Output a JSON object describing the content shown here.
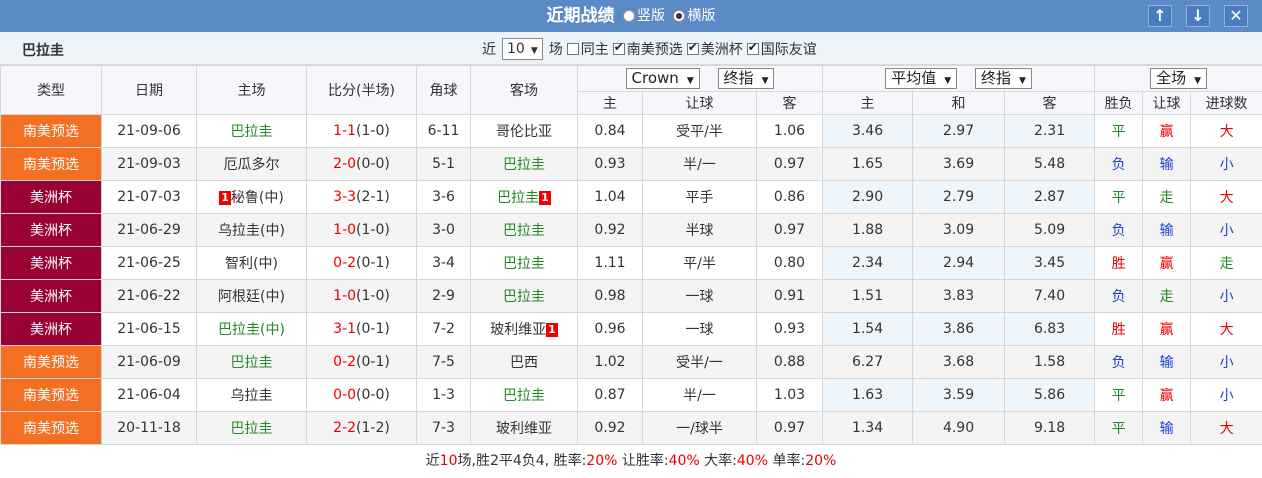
{
  "header": {
    "title": "近期战绩",
    "layout_options": [
      {
        "label": "竖版",
        "selected": false
      },
      {
        "label": "横版",
        "selected": true
      }
    ],
    "buttons": [
      "↑",
      "↓",
      "✕"
    ]
  },
  "filter": {
    "team": "巴拉圭",
    "recent_prefix": "近",
    "recent_count": "10",
    "recent_suffix": "场",
    "checkboxes": [
      {
        "label": "同主",
        "checked": false
      },
      {
        "label": "南美预选",
        "checked": true
      },
      {
        "label": "美洲杯",
        "checked": true
      },
      {
        "label": "国际友谊",
        "checked": true
      }
    ]
  },
  "table": {
    "headers": {
      "type": "类型",
      "date": "日期",
      "home": "主场",
      "score": "比分(半场)",
      "corners": "角球",
      "away": "客场",
      "odds_company": "Crown",
      "odds_kind": "终指",
      "eu_type": "平均值",
      "eu_kind": "终指",
      "result_scope": "全场",
      "sub": {
        "ah_home": "主",
        "ah_line": "让球",
        "ah_away": "客",
        "eu_home": "主",
        "eu_draw": "和",
        "eu_away": "客",
        "wdl": "胜负",
        "handicap_result": "让球",
        "goals": "进球数"
      }
    },
    "rows": [
      {
        "league": "南美预选",
        "league_color": "#f36f21",
        "date": "21-09-06",
        "home": "巴拉圭",
        "home_color": "green",
        "home_rank": "",
        "score": "1-1",
        "half": "(1-0)",
        "corners": "6-11",
        "away": "哥伦比亚",
        "away_color": "normal",
        "away_rank": "",
        "ah_home": "0.84",
        "ah_line": "受平/半",
        "ah_away": "1.06",
        "eu_home": "3.46",
        "eu_draw": "2.97",
        "eu_away": "2.31",
        "wdl": "平",
        "wdl_color": "green",
        "hr": "赢",
        "hr_color": "red",
        "goals": "大",
        "goals_color": "red"
      },
      {
        "league": "南美预选",
        "league_color": "#f36f21",
        "date": "21-09-03",
        "home": "厄瓜多尔",
        "home_color": "normal",
        "home_rank": "",
        "score": "2-0",
        "half": "(0-0)",
        "corners": "5-1",
        "away": "巴拉圭",
        "away_color": "green",
        "away_rank": "",
        "ah_home": "0.93",
        "ah_line": "半/一",
        "ah_away": "0.97",
        "eu_home": "1.65",
        "eu_draw": "3.69",
        "eu_away": "5.48",
        "wdl": "负",
        "wdl_color": "blue",
        "hr": "输",
        "hr_color": "blue",
        "goals": "小",
        "goals_color": "blue"
      },
      {
        "league": "美洲杯",
        "league_color": "#990033",
        "date": "21-07-03",
        "home": "秘鲁(中)",
        "home_color": "normal",
        "home_rank": "1",
        "score": "3-3",
        "half": "(2-1)",
        "corners": "3-6",
        "away": "巴拉圭",
        "away_color": "green",
        "away_rank": "1",
        "ah_home": "1.04",
        "ah_line": "平手",
        "ah_away": "0.86",
        "eu_home": "2.90",
        "eu_draw": "2.79",
        "eu_away": "2.87",
        "wdl": "平",
        "wdl_color": "green",
        "hr": "走",
        "hr_color": "green",
        "goals": "大",
        "goals_color": "red"
      },
      {
        "league": "美洲杯",
        "league_color": "#990033",
        "date": "21-06-29",
        "home": "乌拉圭(中)",
        "home_color": "normal",
        "home_rank": "",
        "score": "1-0",
        "half": "(1-0)",
        "corners": "3-0",
        "away": "巴拉圭",
        "away_color": "green",
        "away_rank": "",
        "ah_home": "0.92",
        "ah_line": "半球",
        "ah_away": "0.97",
        "eu_home": "1.88",
        "eu_draw": "3.09",
        "eu_away": "5.09",
        "wdl": "负",
        "wdl_color": "blue",
        "hr": "输",
        "hr_color": "blue",
        "goals": "小",
        "goals_color": "blue"
      },
      {
        "league": "美洲杯",
        "league_color": "#990033",
        "date": "21-06-25",
        "home": "智利(中)",
        "home_color": "normal",
        "home_rank": "",
        "score": "0-2",
        "half": "(0-1)",
        "corners": "3-4",
        "away": "巴拉圭",
        "away_color": "green",
        "away_rank": "",
        "ah_home": "1.11",
        "ah_line": "平/半",
        "ah_away": "0.80",
        "eu_home": "2.34",
        "eu_draw": "2.94",
        "eu_away": "3.45",
        "wdl": "胜",
        "wdl_color": "red",
        "hr": "赢",
        "hr_color": "red",
        "goals": "走",
        "goals_color": "green"
      },
      {
        "league": "美洲杯",
        "league_color": "#990033",
        "date": "21-06-22",
        "home": "阿根廷(中)",
        "home_color": "normal",
        "home_rank": "",
        "score": "1-0",
        "half": "(1-0)",
        "corners": "2-9",
        "away": "巴拉圭",
        "away_color": "green",
        "away_rank": "",
        "ah_home": "0.98",
        "ah_line": "一球",
        "ah_away": "0.91",
        "eu_home": "1.51",
        "eu_draw": "3.83",
        "eu_away": "7.40",
        "wdl": "负",
        "wdl_color": "blue",
        "hr": "走",
        "hr_color": "green",
        "goals": "小",
        "goals_color": "blue"
      },
      {
        "league": "美洲杯",
        "league_color": "#990033",
        "date": "21-06-15",
        "home": "巴拉圭(中)",
        "home_color": "green",
        "home_rank": "",
        "score": "3-1",
        "half": "(0-1)",
        "corners": "7-2",
        "away": "玻利维亚",
        "away_color": "normal",
        "away_rank": "1",
        "ah_home": "0.96",
        "ah_line": "一球",
        "ah_away": "0.93",
        "eu_home": "1.54",
        "eu_draw": "3.86",
        "eu_away": "6.83",
        "wdl": "胜",
        "wdl_color": "red",
        "hr": "赢",
        "hr_color": "red",
        "goals": "大",
        "goals_color": "red"
      },
      {
        "league": "南美预选",
        "league_color": "#f36f21",
        "date": "21-06-09",
        "home": "巴拉圭",
        "home_color": "green",
        "home_rank": "",
        "score": "0-2",
        "half": "(0-1)",
        "corners": "7-5",
        "away": "巴西",
        "away_color": "normal",
        "away_rank": "",
        "ah_home": "1.02",
        "ah_line": "受半/一",
        "ah_away": "0.88",
        "eu_home": "6.27",
        "eu_draw": "3.68",
        "eu_away": "1.58",
        "wdl": "负",
        "wdl_color": "blue",
        "hr": "输",
        "hr_color": "blue",
        "goals": "小",
        "goals_color": "blue"
      },
      {
        "league": "南美预选",
        "league_color": "#f36f21",
        "date": "21-06-04",
        "home": "乌拉圭",
        "home_color": "normal",
        "home_rank": "",
        "score": "0-0",
        "half": "(0-0)",
        "corners": "1-3",
        "away": "巴拉圭",
        "away_color": "green",
        "away_rank": "",
        "ah_home": "0.87",
        "ah_line": "半/一",
        "ah_away": "1.03",
        "eu_home": "1.63",
        "eu_draw": "3.59",
        "eu_away": "5.86",
        "wdl": "平",
        "wdl_color": "green",
        "hr": "赢",
        "hr_color": "red",
        "goals": "小",
        "goals_color": "blue"
      },
      {
        "league": "南美预选",
        "league_color": "#f36f21",
        "date": "20-11-18",
        "home": "巴拉圭",
        "home_color": "green",
        "home_rank": "",
        "score": "2-2",
        "half": "(1-2)",
        "corners": "7-3",
        "away": "玻利维亚",
        "away_color": "normal",
        "away_rank": "",
        "ah_home": "0.92",
        "ah_line": "一/球半",
        "ah_away": "0.97",
        "eu_home": "1.34",
        "eu_draw": "4.90",
        "eu_away": "9.18",
        "wdl": "平",
        "wdl_color": "green",
        "hr": "输",
        "hr_color": "blue",
        "goals": "大",
        "goals_color": "red"
      }
    ]
  },
  "summary": {
    "p1": "近",
    "matches": "10",
    "p2": "场,胜2平4负4, 胜率:",
    "win_rate": "20%",
    "p3": " 让胜率:",
    "ah_win_rate": "40%",
    "p4": " 大率:",
    "over_rate": "40%",
    "p5": " 单率:",
    "odd_rate": "20%"
  }
}
